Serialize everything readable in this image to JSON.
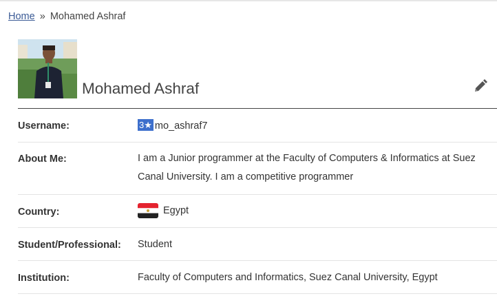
{
  "breadcrumb": {
    "home": "Home",
    "separator": "»",
    "current": "Mohamed Ashraf"
  },
  "profile": {
    "display_name": "Mohamed Ashraf",
    "avatar_icon": "user-photo",
    "edit_icon": "pencil-icon",
    "fields": {
      "username": {
        "label": "Username:",
        "rating": "3★",
        "rating_color": "#3d6fcc",
        "value": "mo_ashraf7"
      },
      "about": {
        "label": "About Me:",
        "value": "I am a Junior programmer at the Faculty of Computers & Informatics at Suez Canal University. I am a competitive programmer"
      },
      "country": {
        "label": "Country:",
        "flag_icon": "egypt-flag-icon",
        "value": "Egypt"
      },
      "student_professional": {
        "label": "Student/Professional:",
        "value": "Student"
      },
      "institution": {
        "label": "Institution:",
        "value": "Faculty of Computers and Informatics, Suez Canal University, Egypt"
      }
    }
  }
}
